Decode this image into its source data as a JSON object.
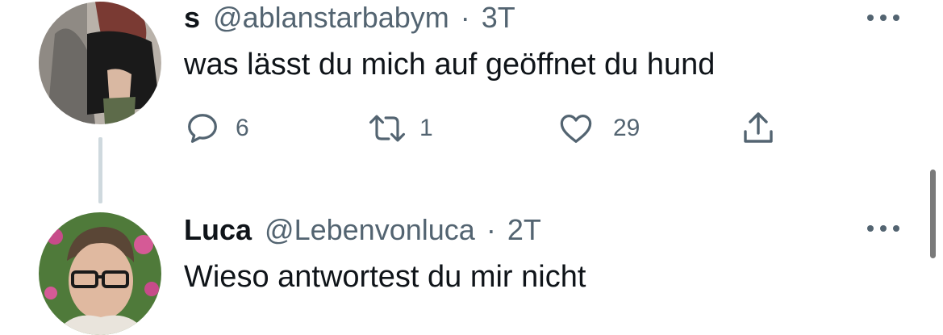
{
  "tweets": [
    {
      "display_name": "s",
      "handle": "@ablanstarbabym",
      "separator": "·",
      "time": "3T",
      "text": "was lässt du mich auf geöffnet du hund",
      "avatar_icon": "avatar-photo",
      "counts": {
        "replies": "6",
        "retweets": "1",
        "likes": "29"
      },
      "icons": {
        "reply": "reply-icon",
        "retweet": "retweet-icon",
        "like": "heart-icon",
        "share": "share-icon",
        "more": "more-icon"
      }
    },
    {
      "display_name": "Luca",
      "handle": "@Lebenvonluca",
      "separator": "·",
      "time": "2T",
      "text": "Wieso antwortest du mir nicht",
      "avatar_icon": "avatar-photo",
      "icons": {
        "more": "more-icon"
      }
    }
  ],
  "colors": {
    "text_primary": "#0f1419",
    "text_secondary": "#536471",
    "thread_line": "#cfd9de"
  }
}
